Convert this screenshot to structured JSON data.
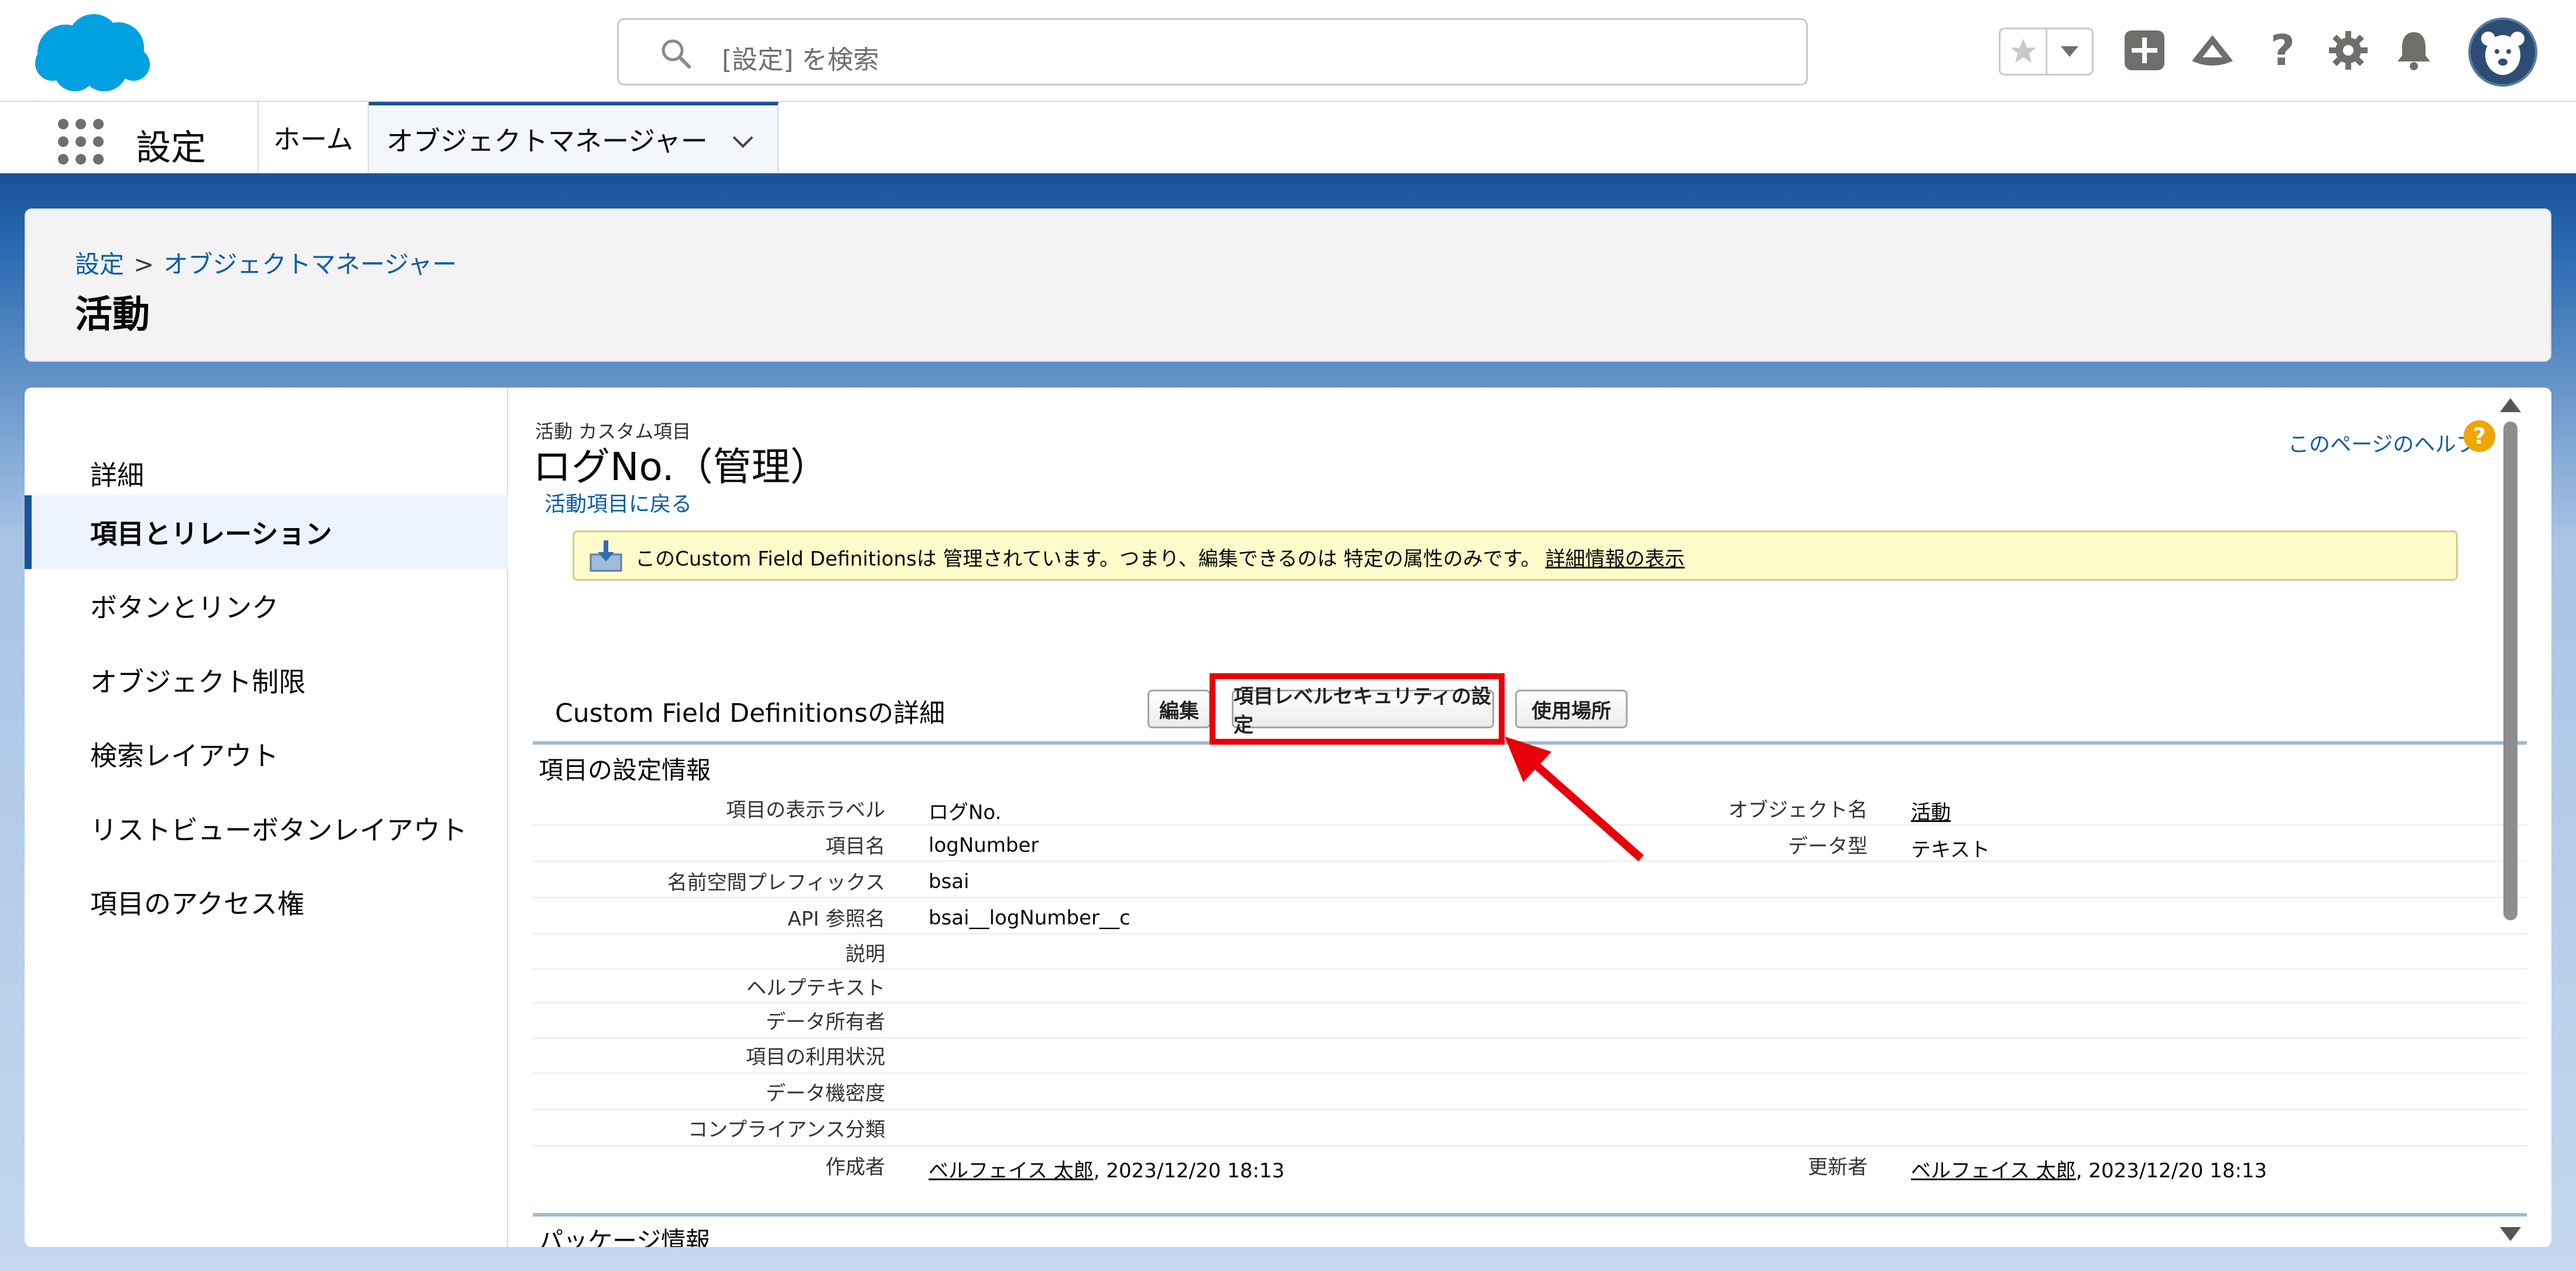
{
  "header": {
    "search_placeholder": "[設定] を検索",
    "icons": [
      "salesforce-cloud-logo",
      "search-icon",
      "star-icon",
      "chevron-down-icon",
      "plus-icon",
      "trailhead-icon",
      "help-icon",
      "gear-icon",
      "bell-icon",
      "avatar"
    ]
  },
  "nav": {
    "app_name": "設定",
    "tab_home": "ホーム",
    "tab_object_manager": "オブジェクトマネージャー"
  },
  "page_header": {
    "breadcrumb_setup": "設定",
    "breadcrumb_sep": ">",
    "breadcrumb_object_manager": "オブジェクトマネージャー",
    "title": "活動"
  },
  "sidebar": {
    "items": [
      {
        "label": "詳細"
      },
      {
        "label": "項目とリレーション"
      },
      {
        "label": "ボタンとリンク"
      },
      {
        "label": "オブジェクト制限"
      },
      {
        "label": "検索レイアウト"
      },
      {
        "label": "リストビューボタンレイアウト"
      },
      {
        "label": "項目のアクセス権"
      }
    ]
  },
  "content": {
    "subtitle": "活動 カスタム項目",
    "title": "ログNo.（管理）",
    "back_link": "活動項目に戻る",
    "help_link": "このページのヘルプ",
    "notice_text": "このCustom Field Definitionsは 管理されています。つまり、編集できるのは 特定の属性のみです。",
    "notice_link": "詳細情報の表示",
    "detail_title": "Custom Field Definitionsの詳細",
    "buttons": {
      "edit": "編集",
      "fls": "項目レベルセキュリティの設定",
      "where_used": "使用場所"
    },
    "section_title": "項目の設定情報",
    "left_fields": [
      {
        "label": "項目の表示ラベル",
        "value": "ログNo."
      },
      {
        "label": "項目名",
        "value": "logNumber"
      },
      {
        "label": "名前空間プレフィックス",
        "value": "bsai"
      },
      {
        "label": "API 参照名",
        "value": "bsai__logNumber__c"
      },
      {
        "label": "説明",
        "value": ""
      },
      {
        "label": "ヘルプテキスト",
        "value": ""
      },
      {
        "label": "データ所有者",
        "value": ""
      },
      {
        "label": "項目の利用状況",
        "value": ""
      },
      {
        "label": "データ機密度",
        "value": ""
      },
      {
        "label": "コンプライアンス分類",
        "value": ""
      }
    ],
    "right_fields": [
      {
        "label": "オブジェクト名",
        "value": "活動"
      },
      {
        "label": "データ型",
        "value": "テキスト"
      }
    ],
    "created_label": "作成者",
    "created_user": "ベルフェイス 太郎",
    "created_date": ", 2023/12/20 18:13",
    "updated_label": "更新者",
    "updated_user": "ベルフェイス 太郎",
    "updated_date": ", 2023/12/20 18:13",
    "package_section": "パッケージ情報"
  },
  "annotation": {
    "color": "#e8000b"
  }
}
